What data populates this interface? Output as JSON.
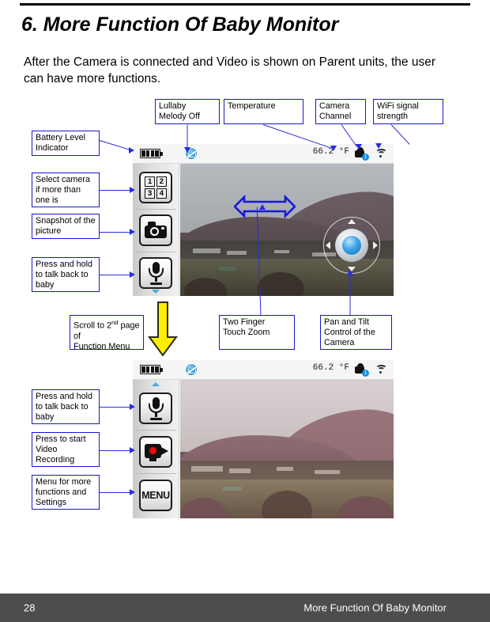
{
  "document": {
    "chapter_number": "6.",
    "chapter_title": "6.  More Function Of Baby Monitor",
    "intro_paragraph": "After the Camera is connected and Video is shown on Parent units,  the user can have more functions."
  },
  "footer": {
    "page_number": "28",
    "running_title": "More Function Of Baby Monitor"
  },
  "callouts": {
    "lullaby": "Lullaby\nMelody Off",
    "temperature": "Temperature",
    "camera_channel": "Camera\nChannel",
    "wifi_signal": "WiFi signal\nstrength",
    "battery_level": "Battery Level\nIndicator",
    "select_camera": "Select camera\nif more than\none is",
    "snapshot": "Snapshot of the\npicture",
    "talk_back_1": "Press and hold\nto talk back to\nbaby",
    "scroll_page2_a": "Scroll to 2",
    "scroll_page2_sup": "nd",
    "scroll_page2_b": " page of\nFunction Menu",
    "two_finger_zoom": "Two Finger\nTouch Zoom",
    "pan_tilt": "Pan and Tilt\nControl of the\nCamera",
    "talk_back_2": "Press and hold\nto talk back to\nbaby",
    "video_record": "Press to start\nVideo\nRecording",
    "menu": "Menu for more\nfunctions and\nSettings"
  },
  "device_top": {
    "status_bar": {
      "battery_icon": "battery-icon",
      "battery_bars": 4,
      "melody_icon": "melody-off-icon",
      "temperature_value": "66.2 °F",
      "camera_channel_icon": "camera-channel-icon",
      "camera_channel_number": "1",
      "wifi_icon": "wifi-signal-icon"
    },
    "sidebar_buttons": [
      {
        "name": "camera-select-button",
        "icon": "camera-grid-icon",
        "labels": [
          "1",
          "2",
          "3",
          "4"
        ]
      },
      {
        "name": "snapshot-button",
        "icon": "photo-camera-icon",
        "label": ""
      },
      {
        "name": "talk-back-button",
        "icon": "microphone-icon",
        "label": ""
      }
    ],
    "scroll_down_icon": "scroll-down-icon",
    "pan_tilt_control": "pan-tilt-joystick",
    "zoom_gesture_icon": "two-finger-zoom-arrow"
  },
  "device_bottom": {
    "status_bar": {
      "battery_icon": "battery-icon",
      "battery_bars": 4,
      "melody_icon": "melody-off-icon",
      "temperature_value": "66.2 °F",
      "camera_channel_icon": "camera-channel-icon",
      "camera_channel_number": "1",
      "wifi_icon": "wifi-signal-icon"
    },
    "scroll_up_icon": "scroll-up-icon",
    "sidebar_buttons": [
      {
        "name": "talk-back-button",
        "icon": "microphone-icon",
        "label": ""
      },
      {
        "name": "video-record-button",
        "icon": "video-record-icon",
        "label": ""
      },
      {
        "name": "menu-button",
        "icon": "menu-icon",
        "label": "MENU"
      }
    ]
  },
  "colors": {
    "callout_border": "#1717c9",
    "leader_line": "#2b2bdd",
    "yellow_arrow_fill": "#ffee00",
    "yellow_arrow_stroke": "#000000",
    "footer_bar": "#4d4d4d",
    "joystick_blue": "#3aa3e8",
    "record_dot_red": "#e01010",
    "scroll_arrow_blue": "#4aa8e0"
  }
}
